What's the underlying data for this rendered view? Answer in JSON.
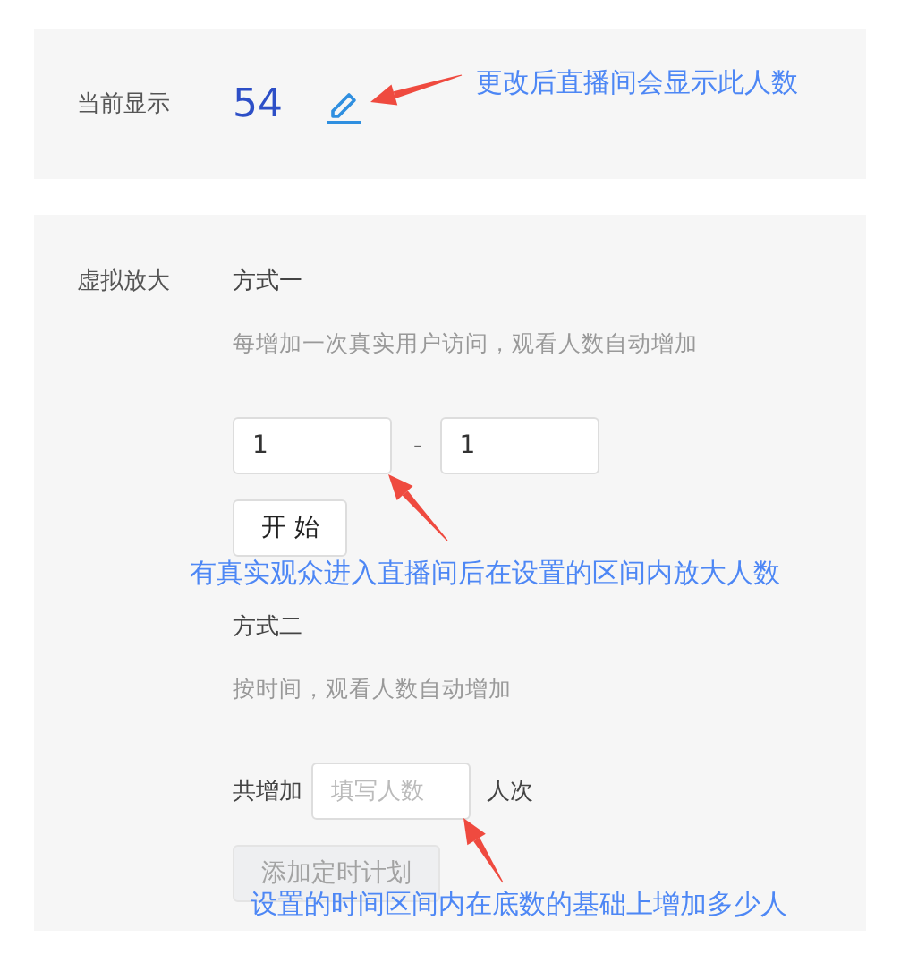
{
  "current_display": {
    "label": "当前显示",
    "value": "54"
  },
  "virtual_amplify": {
    "label": "虚拟放大",
    "methods": [
      {
        "kind": "range",
        "title": "方式一",
        "description": "每增加一次真实用户访问，观看人数自动增加",
        "from": "1",
        "separator": "-",
        "to": "1",
        "button": {
          "label": "开 始",
          "disabled": false
        }
      },
      {
        "kind": "timed",
        "title": "方式二",
        "description": "按时间，观看人数自动增加",
        "prefix": "共增加",
        "placeholder": "填写人数",
        "suffix": "人次",
        "button": {
          "label": "添加定时计划",
          "disabled": true
        }
      }
    ]
  },
  "annotations": [
    {
      "text": "更改后直播间会显示此人数"
    },
    {
      "text": "有真实观众进入直播间后在设置的区间内放大人数"
    },
    {
      "text": "设置的时间区间内在底数的基础上增加多少人"
    }
  ]
}
